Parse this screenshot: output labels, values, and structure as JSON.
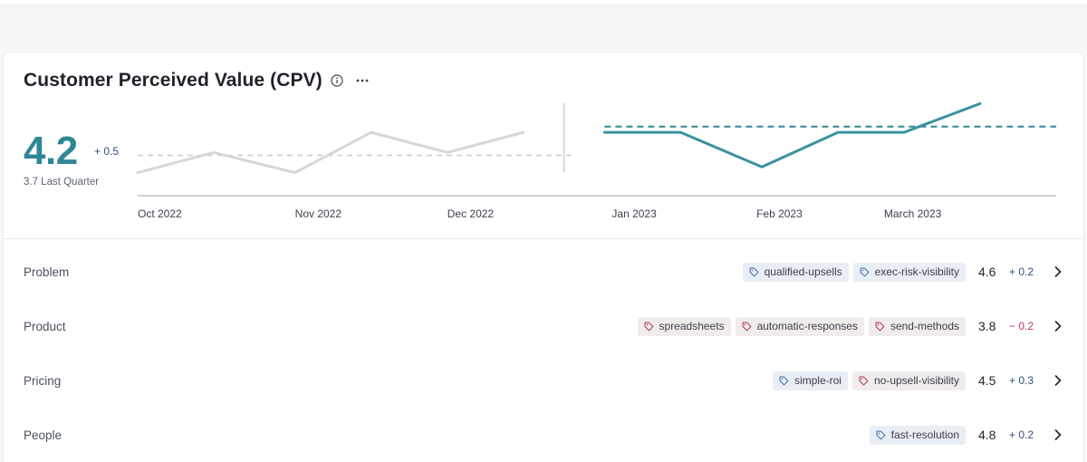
{
  "card": {
    "title": "Customer Perceived Value (CPV)",
    "info_icon": "info-icon",
    "more_icon": "more-horizontal-icon"
  },
  "summary": {
    "score": "4.2",
    "delta": "+ 0.5",
    "last_quarter_label": "3.7 Last Quarter"
  },
  "chart_data": {
    "type": "line",
    "x_ticks": [
      "Oct 2022",
      "Nov 2022",
      "Dec 2022",
      "Jan 2023",
      "Feb 2023",
      "March 2023"
    ],
    "series": [
      {
        "period": "previous quarter",
        "color": "#d7d7d9",
        "points": [
          {
            "x": "2022-10-01",
            "y": 3.4
          },
          {
            "x": "2022-10-16",
            "y": 3.75
          },
          {
            "x": "2022-11-01",
            "y": 3.4
          },
          {
            "x": "2022-11-16",
            "y": 4.1
          },
          {
            "x": "2022-12-01",
            "y": 3.75
          },
          {
            "x": "2022-12-16",
            "y": 4.1
          }
        ],
        "average": 3.7,
        "average_color": "#c9c9cc"
      },
      {
        "period": "current quarter",
        "color": "#3a92a1",
        "points": [
          {
            "x": "2023-01-01",
            "y": 4.1
          },
          {
            "x": "2023-01-16",
            "y": 4.1
          },
          {
            "x": "2023-02-01",
            "y": 3.5
          },
          {
            "x": "2023-02-16",
            "y": 4.1
          },
          {
            "x": "2023-03-01",
            "y": 4.1
          },
          {
            "x": "2023-03-16",
            "y": 4.6
          }
        ],
        "average": 4.2,
        "average_color": "#2f8796"
      }
    ],
    "ylim": [
      3.0,
      4.7
    ],
    "grid": false
  },
  "rows": [
    {
      "label": "Problem",
      "tags": [
        {
          "text": "qualified-upsells",
          "variant": "blue"
        },
        {
          "text": "exec-risk-visibility",
          "variant": "blue"
        }
      ],
      "score": "4.6",
      "delta": "+ 0.2",
      "delta_sign": "pos"
    },
    {
      "label": "Product",
      "tags": [
        {
          "text": "spreadsheets",
          "variant": "red"
        },
        {
          "text": "automatic-responses",
          "variant": "red"
        },
        {
          "text": "send-methods",
          "variant": "red"
        }
      ],
      "score": "3.8",
      "delta": "− 0.2",
      "delta_sign": "neg"
    },
    {
      "label": "Pricing",
      "tags": [
        {
          "text": "simple-roi",
          "variant": "blue"
        },
        {
          "text": "no-upsell-visibility",
          "variant": "red"
        }
      ],
      "score": "4.5",
      "delta": "+ 0.3",
      "delta_sign": "pos"
    },
    {
      "label": "People",
      "tags": [
        {
          "text": "fast-resolution",
          "variant": "blue"
        }
      ],
      "score": "4.8",
      "delta": "+ 0.2",
      "delta_sign": "pos"
    }
  ],
  "colors": {
    "accent": "#2f8796",
    "positive": "#2d4f80",
    "negative": "#c0365a",
    "tag_blue_icon": "#4a76b3",
    "tag_red_icon": "#b5405c"
  }
}
